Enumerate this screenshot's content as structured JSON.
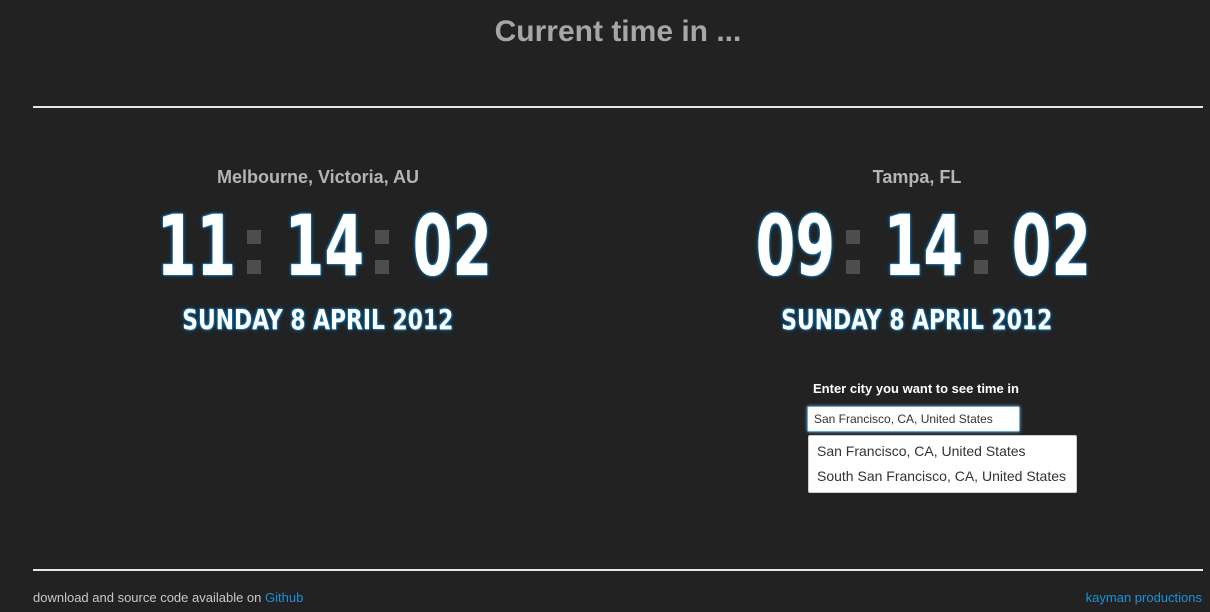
{
  "header": {
    "title": "Current time in ..."
  },
  "clocks": [
    {
      "city": "Melbourne, Victoria, AU",
      "hours": "11",
      "minutes": "14",
      "seconds": "02",
      "date": "SUNDAY 8 APRIL 2012"
    },
    {
      "city": "Tampa, FL",
      "hours": "09",
      "minutes": "14",
      "seconds": "02",
      "date": "SUNDAY 8 APRIL 2012"
    }
  ],
  "search": {
    "label": "Enter city you want to see time in",
    "value": "San Francisco, CA, United States",
    "suggestions": [
      "San Francisco, CA, United States",
      "South San Francisco, CA, United States"
    ]
  },
  "footer": {
    "text": "download and source code available on",
    "github_link": "Github",
    "credit_link": "kayman productions"
  },
  "colors": {
    "background": "#222222",
    "accent": "#1e90d6",
    "glow": "#1e7fb5"
  }
}
